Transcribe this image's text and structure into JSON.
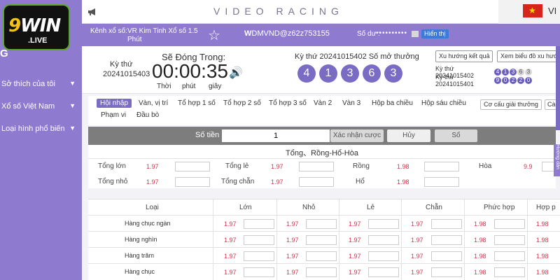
{
  "logo": {
    "brand": "9WIN",
    "sub": ".LIVE",
    "side_initial": "G"
  },
  "sidebar": {
    "items": [
      {
        "label": "Sở thích của tôi"
      },
      {
        "label": "Xổ số Việt Nam"
      },
      {
        "label": "Loại hình phổ biến"
      }
    ]
  },
  "header": {
    "title": "VIDEO RACING",
    "lang": "VI"
  },
  "info": {
    "channel_label": "Kênh xổ số:",
    "channel_value": "VR Kim Tinh Xổ số 1.5 Phút",
    "user": "DMVND@z62z753155",
    "balance_label": "Số dư :",
    "balance_value": "••••••••••",
    "show_label": "Hiển thị"
  },
  "draw": {
    "prev_label": "Kỳ thứ",
    "prev_issue": "20241015403",
    "close_label": "Sẽ Đóng Trong:",
    "countdown": "00:00:35",
    "unit_hour": "Thời",
    "unit_min": "phút",
    "unit_sec": "giây",
    "current_issue": "Kỳ thứ 20241015402  Số mở thưởng",
    "balls": [
      "4",
      "1",
      "3",
      "6",
      "3"
    ],
    "trend_label": "Xu hướng kết quả",
    "chart_label": "Xem biểu đồ xu hướng",
    "history": [
      {
        "issue": "Kỳ thứ 20241015402",
        "digits": [
          "4",
          "1",
          "3",
          "6",
          "3"
        ],
        "on": [
          true,
          true,
          true,
          false,
          false
        ]
      },
      {
        "issue": "Kỳ thứ 20241015401",
        "digits": [
          "9",
          "0",
          "2",
          "2",
          "0"
        ],
        "on": [
          true,
          true,
          true,
          true,
          true
        ]
      }
    ]
  },
  "tabs": {
    "items": [
      {
        "label": "Hội nhập"
      },
      {
        "label": "Vàn, vị trí"
      },
      {
        "label": "Tổ hợp 1 số"
      },
      {
        "label": "Tổ hợp 2 số"
      },
      {
        "label": "Tổ hợp 3 số"
      },
      {
        "label": "Vàn 2"
      },
      {
        "label": "Vàn 3"
      },
      {
        "label": "Hộp ba chiều"
      },
      {
        "label": "Hộp sáu chiều"
      },
      {
        "label": "Phạm vi"
      },
      {
        "label": "Đầu bò"
      }
    ],
    "structure_btn": "Cơ cấu giải thưởng",
    "extra_btn": "Cà"
  },
  "amount": {
    "label": "Số tiền",
    "value": "1",
    "confirm": "Xác nhận cược",
    "cancel": "Hủy",
    "number": "Số"
  },
  "section1": {
    "title": "Tổng、Rồng-Hổ-Hòa",
    "cells": [
      {
        "label": "Tổng lớn",
        "odds": "1.97"
      },
      {
        "label": "Tổng nhỏ",
        "odds": "1.97"
      },
      {
        "label": "Tổng lẻ",
        "odds": "1.97"
      },
      {
        "label": "Tổng chẵn",
        "odds": "1.97"
      },
      {
        "label": "Rồng",
        "odds": "1.98"
      },
      {
        "label": "Hổ",
        "odds": "1.98"
      },
      {
        "label": "Hòa",
        "odds": "9.9"
      }
    ]
  },
  "section2": {
    "headers": [
      "Loại",
      "Lớn",
      "Nhỏ",
      "Lẻ",
      "Chẵn",
      "Phức hợp",
      "Hợp p"
    ],
    "rows": [
      {
        "label": "Hàng chục ngàn",
        "odds": [
          "1.97",
          "1.97",
          "1.97",
          "1.97",
          "1.98",
          "1.98"
        ]
      },
      {
        "label": "Hàng nghìn",
        "odds": [
          "1.97",
          "1.97",
          "1.97",
          "1.97",
          "1.98",
          "1.98"
        ]
      },
      {
        "label": "Hàng trăm",
        "odds": [
          "1.97",
          "1.97",
          "1.97",
          "1.97",
          "1.98",
          "1.98"
        ]
      },
      {
        "label": "Hàng chục",
        "odds": [
          "1.97",
          "1.97",
          "1.97",
          "1.97",
          "1.98",
          "1.98"
        ]
      }
    ]
  },
  "right_tab": "Hướng dẫn",
  "colors": {
    "sidebar": "#8e7bd0",
    "accent": "#7a6cc4",
    "odds": "#d9334d"
  }
}
